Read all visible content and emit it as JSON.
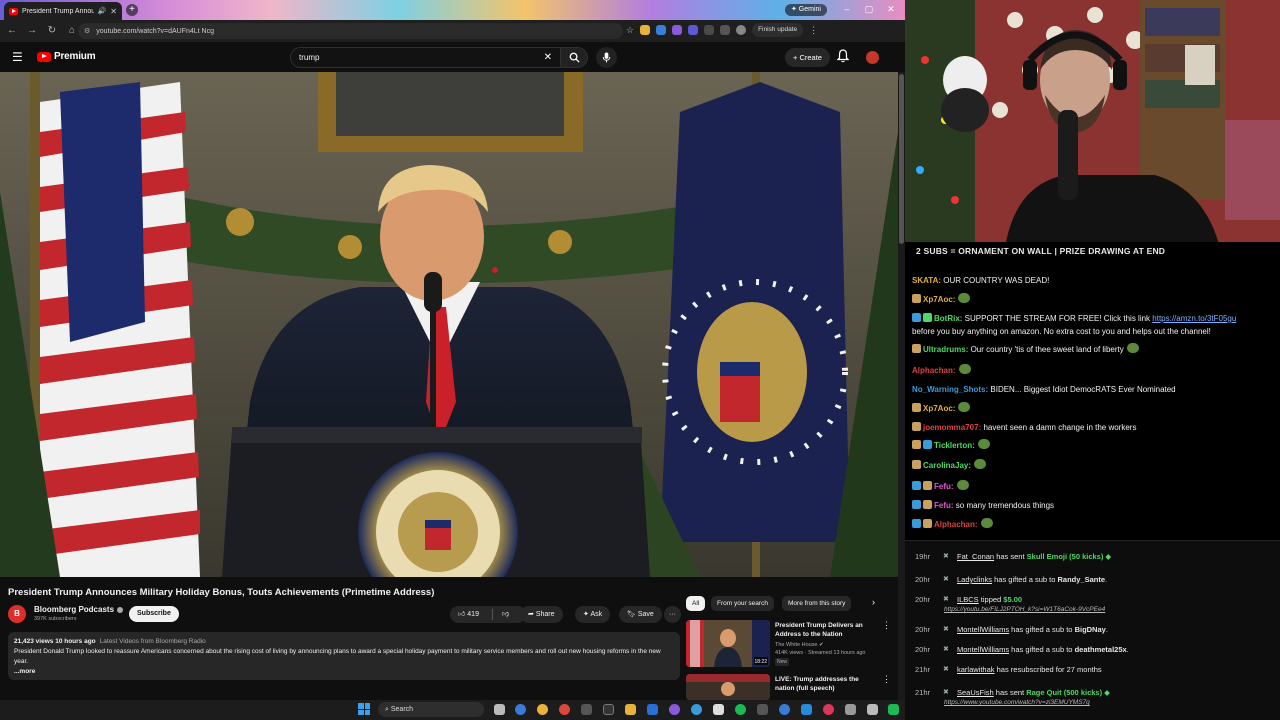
{
  "browser": {
    "tab_title": "President Trump Announce",
    "tab_close": "✕",
    "new_tab": "+",
    "gemini_label": "✦ Gemini",
    "url": "youtube.com/watch?v=dAUFn4Lt Ncg",
    "finish_update": "Finish update"
  },
  "youtube": {
    "logo_text": "Premium",
    "search_value": "trump",
    "create_label": "Create",
    "video_title": "President Trump Announces Military Holiday Bonus, Touts Achievements (Primetime Address)",
    "channel_name": "Bloomberg Podcasts",
    "channel_initial": "B",
    "subscriber_count": "397K subscribers",
    "subscribe_label": "Subscribe",
    "like_count": "419",
    "share_label": "Share",
    "ask_label": "Ask",
    "save_label": "Save",
    "more_label": "···",
    "views_time": "21,423 views  10 hours ago",
    "desc_link": "Latest Videos from Bloomberg Radio",
    "description": "President Donald Trump looked to reassure Americans concerned about the rising cost of living by announcing plans to award a special holiday payment to military service members and roll out new housing reforms in the new year.",
    "desc_more": "...more",
    "chips": [
      "All",
      "From your search",
      "More from this story"
    ],
    "recommendations": [
      {
        "title": "President Trump Delivers an Address to the Nation",
        "channel": "The White House",
        "meta": "414K views · Streamed 13 hours ago",
        "badge": "New",
        "duration": "18:22"
      },
      {
        "title": "LIVE: Trump addresses the nation (full speech)",
        "channel": "",
        "meta": "",
        "badge": "",
        "duration": ""
      }
    ]
  },
  "stream": {
    "banner": "2 SUBS = ORNAMENT ON WALL | PRIZE DRAWING AT END",
    "chat": [
      {
        "user": "SKATA:",
        "color": "#e0b03a",
        "text": " OUR COUNTRY WAS DEAD!",
        "badges": []
      },
      {
        "user": "Xp7Aoc:",
        "color": "#e0b03a",
        "text": "",
        "badges": [
          "#c8a060"
        ],
        "emote": true
      },
      {
        "user": "BotRix:",
        "color": "#4cd964",
        "text": " SUPPORT THE STREAM FOR FREE! Click this link ",
        "link": "https://amzn.to/3tF05gu",
        "badges": [
          "#3a9bd9",
          "#4cd964"
        ]
      },
      {
        "user": "",
        "color": "#f1f1f1",
        "text": "before you buy anything on amazon. No extra cost to you and helps out the channel!",
        "badges": []
      },
      {
        "user": "Ultradrums:",
        "color": "#4cd964",
        "text": " Our country 'tis of thee sweet land of liberty",
        "badges": [
          "#c8a060"
        ],
        "emote": true
      },
      {
        "user": "Alphachan:",
        "color": "#e04040",
        "text": "",
        "badges": [],
        "emote": true
      },
      {
        "user": "No_Warning_Shots:",
        "color": "#3a9bd9",
        "text": " BIDEN... Biggest Idiot DemocRATS Ever Nominated",
        "badges": []
      },
      {
        "user": "Xp7Aoc:",
        "color": "#e0b03a",
        "text": "",
        "badges": [
          "#c8a060"
        ],
        "emote": true
      },
      {
        "user": "joemomma707:",
        "color": "#e04040",
        "text": " havent seen a damn change in the workers",
        "badges": [
          "#c8a060"
        ]
      },
      {
        "user": "Ticklerton:",
        "color": "#4cd964",
        "text": "",
        "badges": [
          "#c8a060",
          "#3a9bd9"
        ],
        "emote": true
      },
      {
        "user": "CarolinaJay:",
        "color": "#4cd964",
        "text": "",
        "badges": [
          "#c8a060"
        ],
        "emote": true
      },
      {
        "user": "Fefu:",
        "color": "#e05ad0",
        "text": "",
        "badges": [
          "#3a9bd9",
          "#c8a060"
        ],
        "emote": true
      },
      {
        "user": "Fefu:",
        "color": "#e05ad0",
        "text": " so many tremendous things",
        "badges": [
          "#3a9bd9",
          "#c8a060"
        ]
      },
      {
        "user": "Alphachan:",
        "color": "#e04040",
        "text": "",
        "badges": [
          "#3a9bd9",
          "#c8a060"
        ],
        "emote": true
      }
    ],
    "events": [
      {
        "time": "19hr",
        "who": "Fat_Conan",
        "mid": " has sent ",
        "what": "Skull Emoji (50 kicks)",
        "whatClass": "green",
        "tail": ""
      },
      {
        "time": "20hr",
        "who": "Ladyclinks",
        "mid": " has gifted a sub to ",
        "what": "Randy_Sante",
        "whatClass": "bold",
        "tail": "."
      },
      {
        "time": "20hr",
        "who": "ILBCS",
        "mid": " tipped ",
        "what": "$5.00",
        "whatClass": "green",
        "tail": "",
        "url": "https://youtu.be/FILJ2PTOH_k?si=W1T6aCok-9VcPEe4"
      },
      {
        "time": "20hr",
        "who": "MontellWilliams",
        "mid": " has gifted a sub to ",
        "what": "BigDNay",
        "whatClass": "bold",
        "tail": "."
      },
      {
        "time": "20hr",
        "who": "MontellWilliams",
        "mid": " has gifted a sub to ",
        "what": "deathmetal25x",
        "whatClass": "bold",
        "tail": "."
      },
      {
        "time": "21hr",
        "who": "karlawithak",
        "mid": " has resubscribed for 27 months",
        "what": "",
        "whatClass": "",
        "tail": ""
      },
      {
        "time": "21hr",
        "who": "SeaUsFish",
        "mid": " has sent ",
        "what": "Rage Quit (500 kicks)",
        "whatClass": "green",
        "tail": "",
        "url": "https://www.youtube.com/watch?v=zi3EMUYMS7g"
      }
    ]
  },
  "taskbar": {
    "search_label": "Search"
  }
}
